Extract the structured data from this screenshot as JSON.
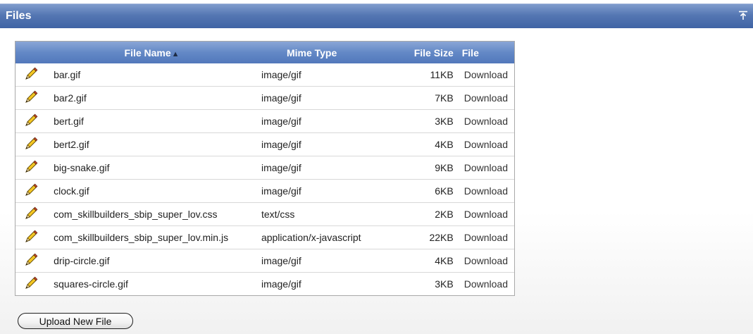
{
  "region": {
    "title": "Files"
  },
  "table": {
    "columns": {
      "file_name": "File Name",
      "sort_indicator": "▲",
      "mime_type": "Mime Type",
      "file_size": "File Size",
      "file": "File"
    },
    "rows": [
      {
        "name": "bar.gif",
        "mime": "image/gif",
        "size": "11KB",
        "link": "Download"
      },
      {
        "name": "bar2.gif",
        "mime": "image/gif",
        "size": "7KB",
        "link": "Download"
      },
      {
        "name": "bert.gif",
        "mime": "image/gif",
        "size": "3KB",
        "link": "Download"
      },
      {
        "name": "bert2.gif",
        "mime": "image/gif",
        "size": "4KB",
        "link": "Download"
      },
      {
        "name": "big-snake.gif",
        "mime": "image/gif",
        "size": "9KB",
        "link": "Download"
      },
      {
        "name": "clock.gif",
        "mime": "image/gif",
        "size": "6KB",
        "link": "Download"
      },
      {
        "name": "com_skillbuilders_sbip_super_lov.css",
        "mime": "text/css",
        "size": "2KB",
        "link": "Download"
      },
      {
        "name": "com_skillbuilders_sbip_super_lov.min.js",
        "mime": "application/x-javascript",
        "size": "22KB",
        "link": "Download"
      },
      {
        "name": "drip-circle.gif",
        "mime": "image/gif",
        "size": "4KB",
        "link": "Download"
      },
      {
        "name": "squares-circle.gif",
        "mime": "image/gif",
        "size": "3KB",
        "link": "Download"
      }
    ]
  },
  "actions": {
    "upload_label": "Upload New File"
  },
  "icons": {
    "edit": "pencil-icon",
    "top": "arrow-up-to-top-icon"
  },
  "colors": {
    "header_blue": "#3f63a4",
    "table_header_blue": "#6388c6"
  }
}
